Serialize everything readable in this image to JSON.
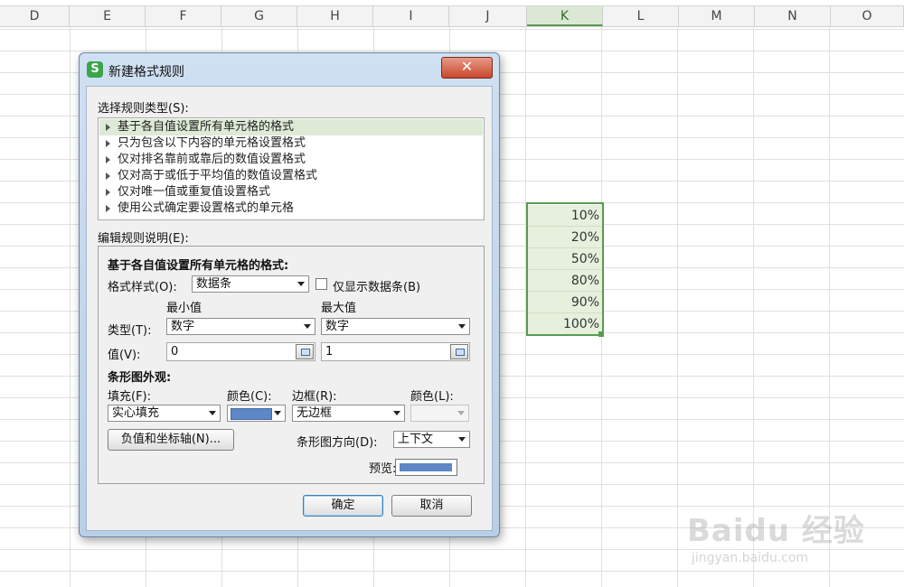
{
  "spreadsheet": {
    "columns": [
      "D",
      "E",
      "F",
      "G",
      "H",
      "I",
      "J",
      "K",
      "L",
      "M",
      "N",
      "O"
    ],
    "selected_column": "K",
    "cells": [
      "10%",
      "20%",
      "50%",
      "80%",
      "90%",
      "100%"
    ]
  },
  "dialog": {
    "app_icon": "S",
    "title": "新建格式规则",
    "close_symbol": "✕",
    "select_rule_type_label": "选择规则类型(S):",
    "rule_types": [
      "基于各自值设置所有单元格的格式",
      "只为包含以下内容的单元格设置格式",
      "仅对排名靠前或靠后的数值设置格式",
      "仅对高于或低于平均值的数值设置格式",
      "仅对唯一值或重复值设置格式",
      "使用公式确定要设置格式的单元格"
    ],
    "edit_rule_label": "编辑规则说明(E):",
    "section_title": "基于各自值设置所有单元格的格式:",
    "format_style_label": "格式样式(O):",
    "format_style_value": "数据条",
    "show_bar_only_label": "仅显示数据条(B)",
    "min_header": "最小值",
    "max_header": "最大值",
    "type_label": "类型(T):",
    "min_type": "数字",
    "max_type": "数字",
    "value_label": "值(V):",
    "min_value": "0",
    "max_value": "1",
    "bar_appearance_label": "条形图外观:",
    "fill_label": "填充(F):",
    "fill_color_label": "颜色(C):",
    "border_label": "边框(R):",
    "border_color_label": "颜色(L):",
    "fill_value": "实心填充",
    "fill_color": "#5d87c6",
    "border_value": "无边框",
    "negative_axis_button": "负值和坐标轴(N)...",
    "direction_label": "条形图方向(D):",
    "direction_value": "上下文",
    "preview_label": "预览:",
    "ok_button": "确定",
    "cancel_button": "取消"
  },
  "watermark": {
    "brand": "Baidu 经验",
    "url": "jingyan.baidu.com"
  }
}
